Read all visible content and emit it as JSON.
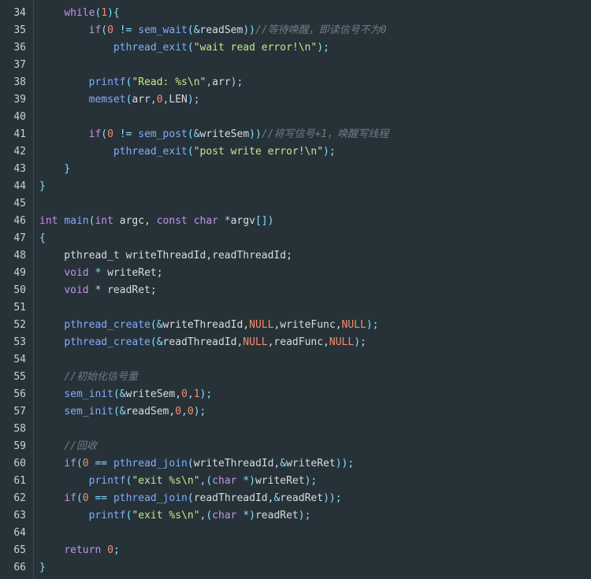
{
  "editor": {
    "colors": {
      "background": "#263238",
      "line_number": "#c9d1d4",
      "plain": "#d6dde0",
      "keyword": "#c792ea",
      "function": "#82aaff",
      "number": "#f78c6c",
      "string": "#c3e88d",
      "operator": "#89ddff",
      "comment": "#6b7f88"
    },
    "lines": [
      {
        "number": "34",
        "tokens": [
          {
            "t": "    ",
            "c": "plain"
          },
          {
            "t": "while",
            "c": "kw"
          },
          {
            "t": "(",
            "c": "punct"
          },
          {
            "t": "1",
            "c": "num"
          },
          {
            "t": "){",
            "c": "punct"
          }
        ]
      },
      {
        "number": "35",
        "tokens": [
          {
            "t": "        ",
            "c": "plain"
          },
          {
            "t": "if",
            "c": "kw"
          },
          {
            "t": "(",
            "c": "punct"
          },
          {
            "t": "0",
            "c": "num"
          },
          {
            "t": " != ",
            "c": "op"
          },
          {
            "t": "sem_wait",
            "c": "fn"
          },
          {
            "t": "(",
            "c": "punct"
          },
          {
            "t": "&",
            "c": "op"
          },
          {
            "t": "readSem",
            "c": "plain"
          },
          {
            "t": "))",
            "c": "punct"
          },
          {
            "t": "//等待唤醒，即读信号不为0",
            "c": "com"
          }
        ]
      },
      {
        "number": "36",
        "tokens": [
          {
            "t": "            ",
            "c": "plain"
          },
          {
            "t": "pthread_exit",
            "c": "fn"
          },
          {
            "t": "(",
            "c": "punct"
          },
          {
            "t": "\"wait read error!\\n\"",
            "c": "str"
          },
          {
            "t": ");",
            "c": "punct"
          }
        ]
      },
      {
        "number": "37",
        "tokens": []
      },
      {
        "number": "38",
        "tokens": [
          {
            "t": "        ",
            "c": "plain"
          },
          {
            "t": "printf",
            "c": "fn"
          },
          {
            "t": "(",
            "c": "punct"
          },
          {
            "t": "\"Read: %s\\n\"",
            "c": "str"
          },
          {
            "t": ",",
            "c": "punct"
          },
          {
            "t": "arr",
            "c": "plain"
          },
          {
            "t": ");",
            "c": "punct"
          }
        ]
      },
      {
        "number": "39",
        "tokens": [
          {
            "t": "        ",
            "c": "plain"
          },
          {
            "t": "memset",
            "c": "fn"
          },
          {
            "t": "(",
            "c": "punct"
          },
          {
            "t": "arr",
            "c": "plain"
          },
          {
            "t": ",",
            "c": "punct"
          },
          {
            "t": "0",
            "c": "num"
          },
          {
            "t": ",",
            "c": "punct"
          },
          {
            "t": "LEN",
            "c": "plain"
          },
          {
            "t": ");",
            "c": "punct"
          }
        ]
      },
      {
        "number": "40",
        "tokens": []
      },
      {
        "number": "41",
        "tokens": [
          {
            "t": "        ",
            "c": "plain"
          },
          {
            "t": "if",
            "c": "kw"
          },
          {
            "t": "(",
            "c": "punct"
          },
          {
            "t": "0",
            "c": "num"
          },
          {
            "t": " != ",
            "c": "op"
          },
          {
            "t": "sem_post",
            "c": "fn"
          },
          {
            "t": "(",
            "c": "punct"
          },
          {
            "t": "&",
            "c": "op"
          },
          {
            "t": "writeSem",
            "c": "plain"
          },
          {
            "t": "))",
            "c": "punct"
          },
          {
            "t": "//将写信号+1，唤醒写线程",
            "c": "com"
          }
        ]
      },
      {
        "number": "42",
        "tokens": [
          {
            "t": "            ",
            "c": "plain"
          },
          {
            "t": "pthread_exit",
            "c": "fn"
          },
          {
            "t": "(",
            "c": "punct"
          },
          {
            "t": "\"post write error!\\n\"",
            "c": "str"
          },
          {
            "t": ");",
            "c": "punct"
          }
        ]
      },
      {
        "number": "43",
        "tokens": [
          {
            "t": "    ",
            "c": "plain"
          },
          {
            "t": "}",
            "c": "punct"
          }
        ]
      },
      {
        "number": "44",
        "tokens": [
          {
            "t": "}",
            "c": "punct"
          }
        ]
      },
      {
        "number": "45",
        "tokens": []
      },
      {
        "number": "46",
        "tokens": [
          {
            "t": "int",
            "c": "kw"
          },
          {
            "t": " ",
            "c": "plain"
          },
          {
            "t": "main",
            "c": "fn"
          },
          {
            "t": "(",
            "c": "punct"
          },
          {
            "t": "int",
            "c": "kw"
          },
          {
            "t": " argc, ",
            "c": "plain"
          },
          {
            "t": "const",
            "c": "kw"
          },
          {
            "t": " ",
            "c": "plain"
          },
          {
            "t": "char",
            "c": "kw"
          },
          {
            "t": " ",
            "c": "plain"
          },
          {
            "t": "*",
            "c": "op"
          },
          {
            "t": "argv",
            "c": "plain"
          },
          {
            "t": "[])",
            "c": "punct"
          }
        ]
      },
      {
        "number": "47",
        "tokens": [
          {
            "t": "{",
            "c": "punct"
          }
        ]
      },
      {
        "number": "48",
        "tokens": [
          {
            "t": "    pthread_t writeThreadId,readThreadId;",
            "c": "plain"
          }
        ]
      },
      {
        "number": "49",
        "tokens": [
          {
            "t": "    ",
            "c": "plain"
          },
          {
            "t": "void",
            "c": "kw"
          },
          {
            "t": " ",
            "c": "plain"
          },
          {
            "t": "*",
            "c": "op"
          },
          {
            "t": " writeRet;",
            "c": "plain"
          }
        ]
      },
      {
        "number": "50",
        "tokens": [
          {
            "t": "    ",
            "c": "plain"
          },
          {
            "t": "void",
            "c": "kw"
          },
          {
            "t": " ",
            "c": "plain"
          },
          {
            "t": "*",
            "c": "op"
          },
          {
            "t": " readRet;",
            "c": "plain"
          }
        ]
      },
      {
        "number": "51",
        "tokens": []
      },
      {
        "number": "52",
        "tokens": [
          {
            "t": "    ",
            "c": "plain"
          },
          {
            "t": "pthread_create",
            "c": "fn"
          },
          {
            "t": "(",
            "c": "punct"
          },
          {
            "t": "&",
            "c": "op"
          },
          {
            "t": "writeThreadId,",
            "c": "plain"
          },
          {
            "t": "NULL",
            "c": "num"
          },
          {
            "t": ",writeFunc,",
            "c": "plain"
          },
          {
            "t": "NULL",
            "c": "num"
          },
          {
            "t": ");",
            "c": "punct"
          }
        ]
      },
      {
        "number": "53",
        "tokens": [
          {
            "t": "    ",
            "c": "plain"
          },
          {
            "t": "pthread_create",
            "c": "fn"
          },
          {
            "t": "(",
            "c": "punct"
          },
          {
            "t": "&",
            "c": "op"
          },
          {
            "t": "readThreadId,",
            "c": "plain"
          },
          {
            "t": "NULL",
            "c": "num"
          },
          {
            "t": ",readFunc,",
            "c": "plain"
          },
          {
            "t": "NULL",
            "c": "num"
          },
          {
            "t": ");",
            "c": "punct"
          }
        ]
      },
      {
        "number": "54",
        "tokens": []
      },
      {
        "number": "55",
        "tokens": [
          {
            "t": "    ",
            "c": "plain"
          },
          {
            "t": "//初始化信号量",
            "c": "com"
          }
        ]
      },
      {
        "number": "56",
        "tokens": [
          {
            "t": "    ",
            "c": "plain"
          },
          {
            "t": "sem_init",
            "c": "fn"
          },
          {
            "t": "(",
            "c": "punct"
          },
          {
            "t": "&",
            "c": "op"
          },
          {
            "t": "writeSem,",
            "c": "plain"
          },
          {
            "t": "0",
            "c": "num"
          },
          {
            "t": ",",
            "c": "punct"
          },
          {
            "t": "1",
            "c": "num"
          },
          {
            "t": ");",
            "c": "punct"
          }
        ]
      },
      {
        "number": "57",
        "tokens": [
          {
            "t": "    ",
            "c": "plain"
          },
          {
            "t": "sem_init",
            "c": "fn"
          },
          {
            "t": "(",
            "c": "punct"
          },
          {
            "t": "&",
            "c": "op"
          },
          {
            "t": "readSem,",
            "c": "plain"
          },
          {
            "t": "0",
            "c": "num"
          },
          {
            "t": ",",
            "c": "punct"
          },
          {
            "t": "0",
            "c": "num"
          },
          {
            "t": ");",
            "c": "punct"
          }
        ]
      },
      {
        "number": "58",
        "tokens": []
      },
      {
        "number": "59",
        "tokens": [
          {
            "t": "    ",
            "c": "plain"
          },
          {
            "t": "//回收",
            "c": "com"
          }
        ]
      },
      {
        "number": "60",
        "tokens": [
          {
            "t": "    ",
            "c": "plain"
          },
          {
            "t": "if",
            "c": "kw"
          },
          {
            "t": "(",
            "c": "punct"
          },
          {
            "t": "0",
            "c": "num"
          },
          {
            "t": " == ",
            "c": "op"
          },
          {
            "t": "pthread_join",
            "c": "fn"
          },
          {
            "t": "(",
            "c": "punct"
          },
          {
            "t": "writeThreadId,",
            "c": "plain"
          },
          {
            "t": "&",
            "c": "op"
          },
          {
            "t": "writeRet",
            "c": "plain"
          },
          {
            "t": "));",
            "c": "punct"
          }
        ]
      },
      {
        "number": "61",
        "tokens": [
          {
            "t": "        ",
            "c": "plain"
          },
          {
            "t": "printf",
            "c": "fn"
          },
          {
            "t": "(",
            "c": "punct"
          },
          {
            "t": "\"exit %s\\n\"",
            "c": "str"
          },
          {
            "t": ",(",
            "c": "punct"
          },
          {
            "t": "char",
            "c": "kw"
          },
          {
            "t": " ",
            "c": "plain"
          },
          {
            "t": "*",
            "c": "op"
          },
          {
            "t": ")",
            "c": "punct"
          },
          {
            "t": "writeRet",
            "c": "plain"
          },
          {
            "t": ");",
            "c": "punct"
          }
        ]
      },
      {
        "number": "62",
        "tokens": [
          {
            "t": "    ",
            "c": "plain"
          },
          {
            "t": "if",
            "c": "kw"
          },
          {
            "t": "(",
            "c": "punct"
          },
          {
            "t": "0",
            "c": "num"
          },
          {
            "t": " == ",
            "c": "op"
          },
          {
            "t": "pthread_join",
            "c": "fn"
          },
          {
            "t": "(",
            "c": "punct"
          },
          {
            "t": "readThreadId,",
            "c": "plain"
          },
          {
            "t": "&",
            "c": "op"
          },
          {
            "t": "readRet",
            "c": "plain"
          },
          {
            "t": "));",
            "c": "punct"
          }
        ]
      },
      {
        "number": "63",
        "tokens": [
          {
            "t": "        ",
            "c": "plain"
          },
          {
            "t": "printf",
            "c": "fn"
          },
          {
            "t": "(",
            "c": "punct"
          },
          {
            "t": "\"exit %s\\n\"",
            "c": "str"
          },
          {
            "t": ",(",
            "c": "punct"
          },
          {
            "t": "char",
            "c": "kw"
          },
          {
            "t": " ",
            "c": "plain"
          },
          {
            "t": "*",
            "c": "op"
          },
          {
            "t": ")",
            "c": "punct"
          },
          {
            "t": "readRet",
            "c": "plain"
          },
          {
            "t": ");",
            "c": "punct"
          }
        ]
      },
      {
        "number": "64",
        "tokens": []
      },
      {
        "number": "65",
        "tokens": [
          {
            "t": "    ",
            "c": "plain"
          },
          {
            "t": "return",
            "c": "kw"
          },
          {
            "t": " ",
            "c": "plain"
          },
          {
            "t": "0",
            "c": "num"
          },
          {
            "t": ";",
            "c": "punct"
          }
        ]
      },
      {
        "number": "66",
        "tokens": [
          {
            "t": "}",
            "c": "punct"
          }
        ]
      }
    ]
  }
}
